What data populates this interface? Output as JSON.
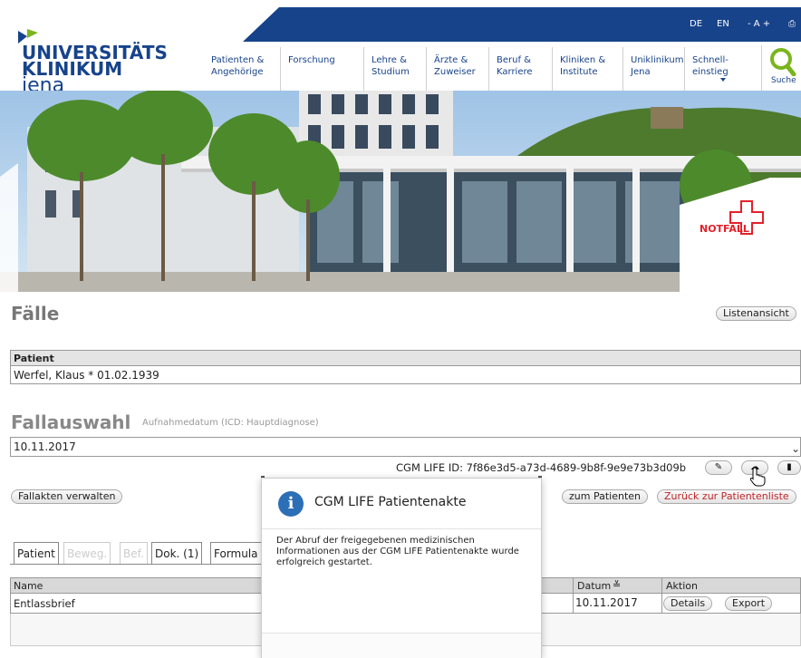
{
  "header": {
    "logo": {
      "line1": "UNIVERSITÄTS",
      "line2": "KLINIKUM",
      "line3": "jena"
    },
    "topbar": {
      "lang_de": "DE",
      "lang_en": "EN",
      "font_size": "- A +"
    },
    "nav": [
      {
        "line1": "Patienten &",
        "line2": "Angehörige"
      },
      {
        "line1": "Forschung",
        "line2": ""
      },
      {
        "line1": "Lehre &",
        "line2": "Studium"
      },
      {
        "line1": "Ärzte &",
        "line2": "Zuweiser"
      },
      {
        "line1": "Beruf &",
        "line2": "Karriere"
      },
      {
        "line1": "Kliniken &",
        "line2": "Institute"
      },
      {
        "line1": "Uniklinikum",
        "line2": "Jena"
      },
      {
        "line1": "Schnell-",
        "line2": "einstieg"
      }
    ],
    "search_label": "Suche",
    "colors": {
      "brand": "#17438b",
      "accent": "#7ab51d",
      "notfall": "#e3212a"
    }
  },
  "hero": {
    "notfall_label": "NOTFALL"
  },
  "page": {
    "title": "Fälle",
    "list_view_button": "Listenansicht",
    "patient_header": "Patient",
    "patient_value": "Werfel, Klaus  * 01.02.1939",
    "fall_title": "Fallauswahl",
    "fall_subtitle": "Aufnahmedatum (ICD: Hauptdiagnose)",
    "fall_value": "10.11.2017",
    "cgm_id": "CGM LIFE ID: 7f86e3d5-a73d-4689-9b8f-9e9e73b3d09b",
    "manage_button": "Fallakten verwalten",
    "to_patient_button": "zum Patienten",
    "back_button": "Zurück zur Patientenliste",
    "tabs": [
      {
        "label": "Patient",
        "disabled": false
      },
      {
        "label": "Beweg.",
        "disabled": true
      },
      {
        "label": "Bef.",
        "disabled": true
      },
      {
        "label": "Dok. (1)",
        "disabled": false
      },
      {
        "label": "Formula",
        "disabled": false
      }
    ],
    "table": {
      "columns": {
        "name": "Name",
        "date": "Datum",
        "action": "Aktion"
      },
      "rows": [
        {
          "name": "Entlassbrief",
          "date": "10.11.2017",
          "details": "Details",
          "export": "Export"
        }
      ]
    }
  },
  "modal": {
    "title": "CGM LIFE Patientenakte",
    "text": "Der Abruf der freigegebenen medizinischen Informationen aus der CGM LIFE Patientenakte wurde erfolgreich gestartet."
  }
}
